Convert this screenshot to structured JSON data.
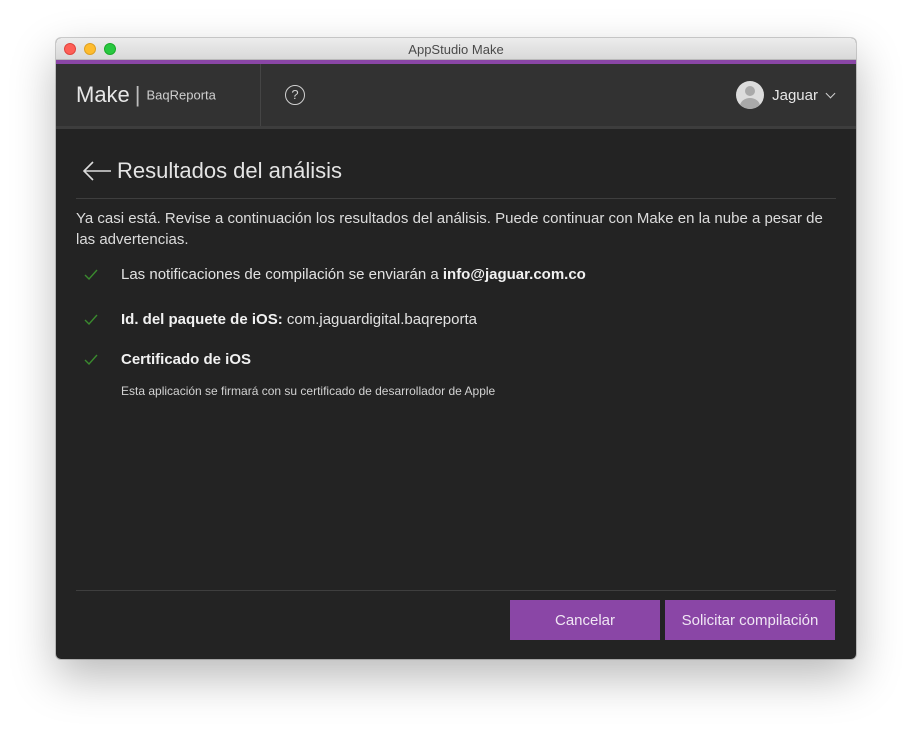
{
  "window": {
    "title": "AppStudio Make"
  },
  "header": {
    "product": "Make",
    "separator": "|",
    "app_name": "BaqReporta",
    "help_icon": "?",
    "user_name": "Jaguar"
  },
  "page": {
    "title": "Resultados del análisis",
    "intro": "Ya casi está. Revise a continuación los resultados del análisis. Puede continuar con Make en la nube a pesar de las advertencias."
  },
  "results": [
    {
      "text_prefix": "Las notificaciones de compilación se enviarán a ",
      "text_bold": "info@jaguar.com.co",
      "status": "ok"
    },
    {
      "bold_label": "Id. del paquete de iOS:",
      "value": " com.jaguardigital.baqreporta",
      "status": "ok"
    },
    {
      "bold_label": "Certificado de iOS",
      "note": "Esta aplicación se firmará con su certificado de desarrollador de Apple",
      "status": "ok"
    }
  ],
  "buttons": {
    "cancel": "Cancelar",
    "submit": "Solicitar compilación"
  },
  "colors": {
    "accent": "#8a46a6",
    "check": "#3a8a2e",
    "background": "#232323",
    "header": "#323232"
  },
  "icons": {
    "back": "back-arrow-icon",
    "help": "help-circle-icon",
    "avatar": "user-avatar-icon",
    "dropdown": "chevron-down-icon",
    "check": "checkmark-icon"
  }
}
